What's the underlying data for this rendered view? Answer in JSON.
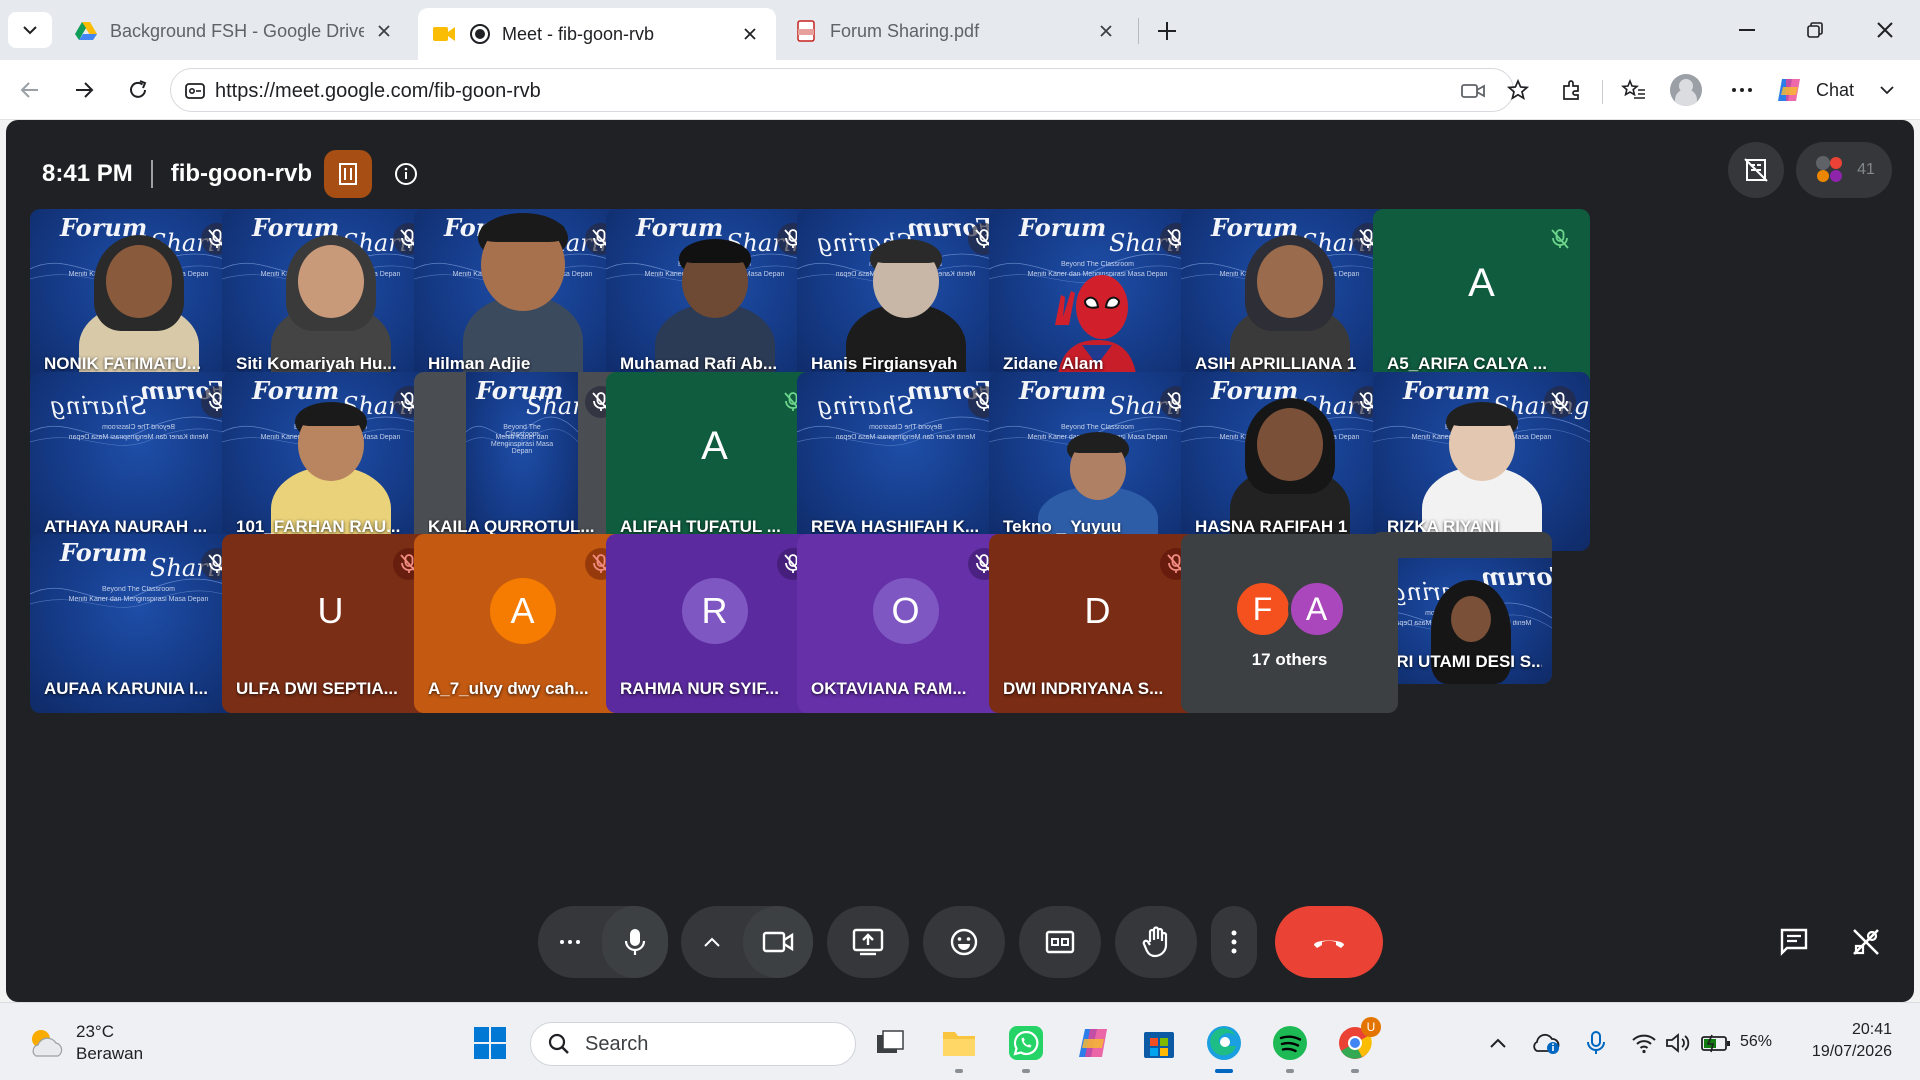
{
  "browser": {
    "tabs": [
      {
        "title": "Background FSH - Google Drive",
        "icon": "google-drive-icon"
      },
      {
        "title": "Meet - fib-goon-rvb",
        "icon": "google-meet-icon",
        "active": true
      },
      {
        "title": "Forum Sharing.pdf",
        "icon": "pdf-icon"
      }
    ],
    "url": "https://meet.google.com/fib-goon-rvb",
    "chat_label": "Chat"
  },
  "meet": {
    "time": "8:41 PM",
    "code": "fib-goon-rvb",
    "participant_count": "41",
    "participants": [
      {
        "name": "NONIK FATIMATU...",
        "kind": "video"
      },
      {
        "name": "Siti Komariyah Hu...",
        "kind": "video"
      },
      {
        "name": "Hilman Adjie",
        "kind": "video"
      },
      {
        "name": "Muhamad Rafi Ab...",
        "kind": "video"
      },
      {
        "name": "Hanis Firgiansyah",
        "kind": "video"
      },
      {
        "name": "Zidane Alam",
        "kind": "video"
      },
      {
        "name": "ASIH APRILLIANA 1",
        "kind": "video"
      },
      {
        "name": "A5_ARIFA CALYA ...",
        "kind": "avatar",
        "initial": "A"
      },
      {
        "name": "ATHAYA NAURAH ...",
        "kind": "video"
      },
      {
        "name": "101_FARHAN RAU...",
        "kind": "video"
      },
      {
        "name": "KAILA QURROTUL...",
        "kind": "video"
      },
      {
        "name": "ALIFAH TUFATUL ...",
        "kind": "avatar",
        "initial": "A"
      },
      {
        "name": "REVA HASHIFAH K...",
        "kind": "video"
      },
      {
        "name": "Tekno _ Yuyuu",
        "kind": "video"
      },
      {
        "name": "HASNA RAFIFAH 1",
        "kind": "video"
      },
      {
        "name": "RIZKA RIYANI",
        "kind": "video"
      },
      {
        "name": "AUFAA KARUNIA I...",
        "kind": "video"
      },
      {
        "name": "ULFA DWI SEPTIA...",
        "kind": "avatar",
        "initial": "U"
      },
      {
        "name": "A_7_ulvy dwy cah...",
        "kind": "avatar",
        "initial": "A"
      },
      {
        "name": "RAHMA NUR SYIF...",
        "kind": "avatar",
        "initial": "R"
      },
      {
        "name": "OKTAVIANA RAM...",
        "kind": "avatar",
        "initial": "O"
      },
      {
        "name": "DWI INDRIYANA S...",
        "kind": "avatar",
        "initial": "D"
      },
      {
        "name": "SRI UTAMI DESI S...",
        "kind": "video",
        "self": true
      }
    ],
    "others": {
      "initials": [
        "F",
        "A"
      ],
      "label": "17 others"
    },
    "background_text": {
      "title1": "Forum",
      "title2": "Sharing",
      "sub1": "Beyond The Classroom",
      "sub2": "Meniti Karier dan Menginspirasi Masa Depan"
    },
    "colors": {
      "end_call": "#ea4335",
      "self_border": "#a8c7fa",
      "host_badge": "#a74e15"
    }
  },
  "taskbar": {
    "weather_temp": "23°C",
    "weather_desc": "Berawan",
    "search_placeholder": "Search",
    "battery": "56%",
    "time": "20:41",
    "date": "19/07/2026",
    "chrome_badge": "U"
  }
}
